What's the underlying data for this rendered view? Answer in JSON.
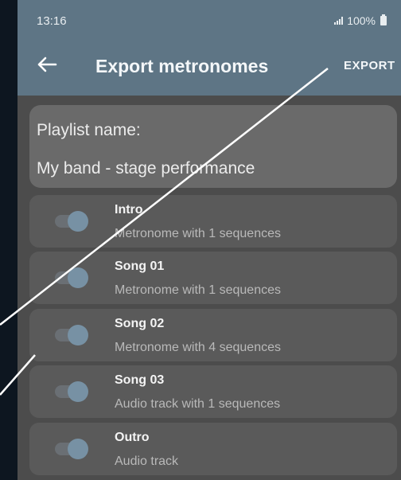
{
  "status_bar": {
    "time": "13:16",
    "battery": "100%",
    "icons": [
      "signal-icon",
      "battery-icon"
    ]
  },
  "app_bar": {
    "back_icon": "arrow-left-icon",
    "title": "Export metronomes",
    "action": "EXPORT"
  },
  "playlist": {
    "label": "Playlist name:",
    "value": "My band - stage performance"
  },
  "items": [
    {
      "name": "Intro",
      "description": "Metronome with 1 sequences",
      "enabled": true
    },
    {
      "name": "Song 01",
      "description": "Metronome with 1 sequences",
      "enabled": true
    },
    {
      "name": "Song 02",
      "description": "Metronome with 4 sequences",
      "enabled": true
    },
    {
      "name": "Song 03",
      "description": "Audio track with 1 sequences",
      "enabled": true
    },
    {
      "name": "Outro",
      "description": "Audio track",
      "enabled": true
    }
  ],
  "colors": {
    "app_bar": "#5e7585",
    "background": "#4c4c4c",
    "card": "#6a6a6a",
    "item": "#5a5a5a",
    "toggle_thumb": "#7791a4",
    "outer": "#0d1620"
  }
}
